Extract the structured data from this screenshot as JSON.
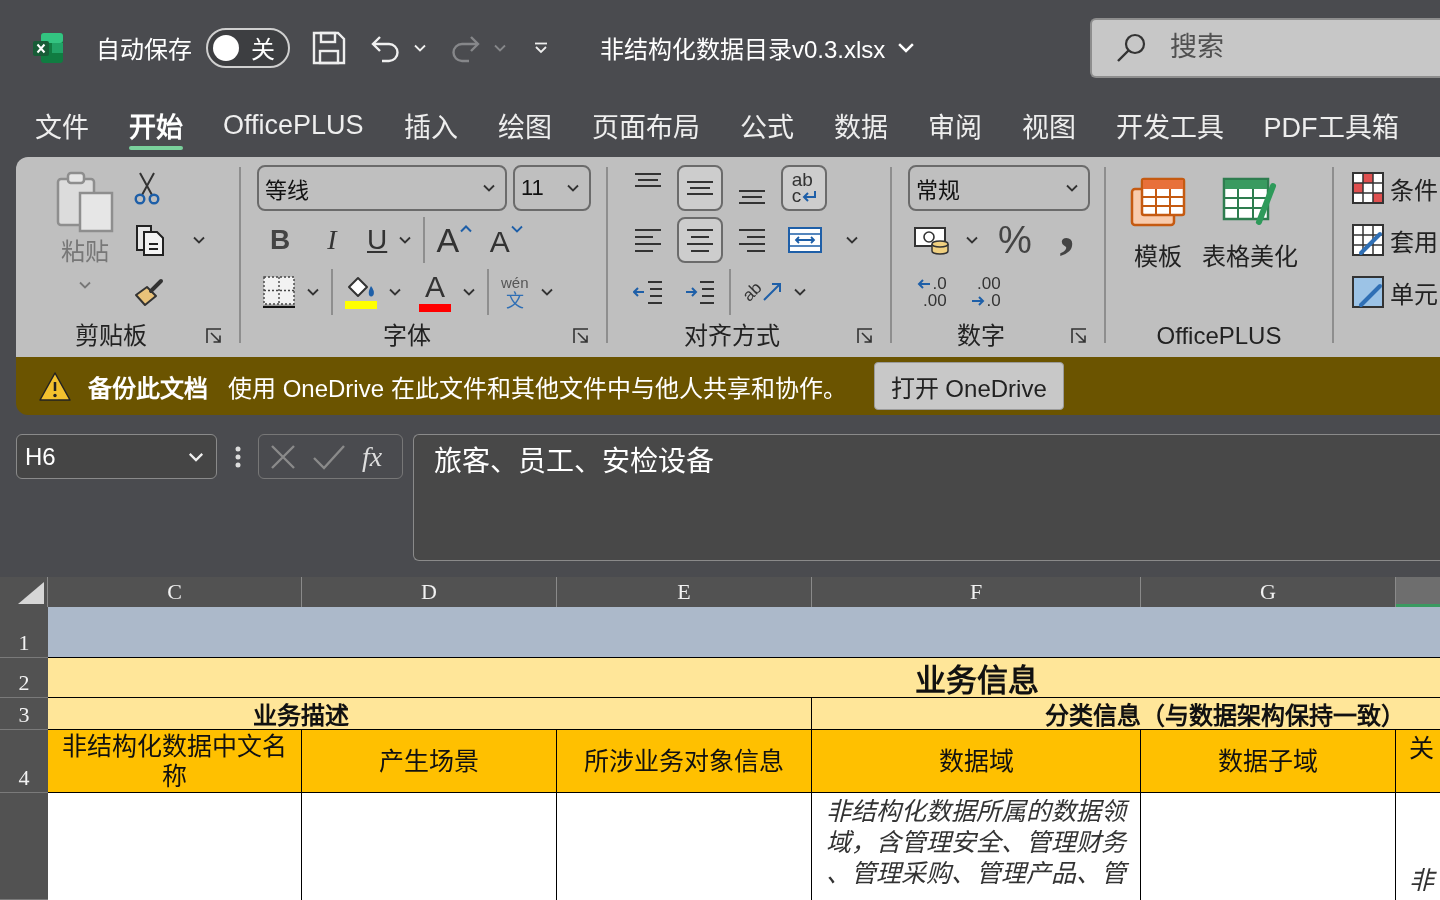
{
  "title_bar": {
    "autosave": {
      "label": "自动保存",
      "on": false,
      "state_label": "关"
    },
    "undo": {
      "disabled": false
    },
    "redo": {
      "disabled": true
    },
    "file_name": "非结构化数据目录v0.3.xlsx",
    "search": {
      "placeholder": "搜索"
    }
  },
  "tabs": [
    {
      "label": "文件",
      "selected": false
    },
    {
      "label": "开始",
      "selected": true
    },
    {
      "label": "OfficePLUS",
      "selected": false
    },
    {
      "label": "插入",
      "selected": false
    },
    {
      "label": "绘图",
      "selected": false
    },
    {
      "label": "页面布局",
      "selected": false
    },
    {
      "label": "公式",
      "selected": false
    },
    {
      "label": "数据",
      "selected": false
    },
    {
      "label": "审阅",
      "selected": false
    },
    {
      "label": "视图",
      "selected": false
    },
    {
      "label": "开发工具",
      "selected": false
    },
    {
      "label": "PDF工具箱",
      "selected": false
    }
  ],
  "ribbon": {
    "groups": [
      {
        "kind": "clipboard",
        "label": "剪贴板",
        "launcher": true,
        "paste": {
          "label": "粘贴",
          "disabled": true
        }
      },
      {
        "kind": "font",
        "label": "字体",
        "launcher": true,
        "font_name": "等线",
        "font_size": "11",
        "bold": "B",
        "italic": "I",
        "underline": "U",
        "grow": "A",
        "shrink": "A",
        "highlight": {
          "color": "#ffff00"
        },
        "font_color": {
          "glyph": "A",
          "color": "#ff0000"
        },
        "phonetic": [
          "wén",
          "文"
        ]
      },
      {
        "kind": "alignment",
        "label": "对齐方式",
        "launcher": true,
        "rows": [
          [
            {
              "kind": "align-top",
              "on": false
            },
            {
              "kind": "align-middle",
              "on": true
            },
            {
              "kind": "align-bottom",
              "on": false
            },
            {
              "kind": "wrap-text",
              "on": true,
              "glyph": [
                "ab",
                "c"
              ]
            }
          ],
          [
            {
              "kind": "align-left",
              "on": false
            },
            {
              "kind": "align-center",
              "on": true
            },
            {
              "kind": "align-right",
              "on": false
            },
            {
              "kind": "merge",
              "on": false
            }
          ],
          [
            {
              "kind": "indent-decrease",
              "on": false
            },
            {
              "kind": "indent-increase",
              "on": false
            },
            {
              "kind": "orientation",
              "on": false,
              "glyph": [
                "ab"
              ]
            }
          ]
        ]
      },
      {
        "kind": "number",
        "label": "数字",
        "launcher": true,
        "format": "常规",
        "percent": "%",
        "comma": ",",
        "increase_decimal": [
          ".0",
          ".00"
        ],
        "decrease_decimal": [
          ".00",
          ".0"
        ]
      },
      {
        "kind": "gallery",
        "label": "OfficePLUS",
        "launcher": false,
        "items": [
          {
            "kind": "template",
            "label": "模板"
          },
          {
            "kind": "beautify",
            "label": "表格美化"
          }
        ]
      },
      {
        "kind": "styles",
        "items": [
          {
            "kind": "conditional",
            "label": "条件"
          },
          {
            "kind": "table-format",
            "label": "套用"
          },
          {
            "kind": "cell-style",
            "label": "单元"
          }
        ]
      }
    ]
  },
  "notification": {
    "title": "备份此文档",
    "message": "使用 OneDrive 在此文件和其他文件中与他人共享和协作。",
    "button": "打开 OneDrive"
  },
  "formula_bar": {
    "name_box": "H6",
    "function_glyph": "fx",
    "formula": "旅客、员工、安检设备"
  },
  "sheet": {
    "columns": [
      {
        "label": "C",
        "selected": false
      },
      {
        "label": "D",
        "selected": false
      },
      {
        "label": "E",
        "selected": false
      },
      {
        "label": "F",
        "selected": false
      },
      {
        "label": "G",
        "selected": false
      },
      {
        "selected": true
      }
    ],
    "rows": [
      {
        "label": "1",
        "kind": "band"
      },
      {
        "label": "2",
        "kind": "title",
        "text": "业务信息"
      },
      {
        "label": "3",
        "kind": "groups",
        "cells": [
          {
            "text": "业务描述"
          },
          {
            "text": "分类信息（与数据架构保持一致）"
          }
        ]
      },
      {
        "label": "4",
        "kind": "header",
        "cells": [
          {
            "text": "非结构化数据中文名称"
          },
          {
            "text": "产生场景"
          },
          {
            "text": "所涉业务对象信息"
          },
          {
            "text": "数据域"
          },
          {
            "text": "数据子域"
          },
          {
            "text": "关"
          }
        ]
      },
      {
        "kind": "body",
        "cells": [
          {
            "kind": "blank"
          },
          {
            "kind": "blank"
          },
          {
            "kind": "blank"
          },
          {
            "kind": "hint",
            "text": "非结构化数据所属的数据领域，含管理安全、管理财务、管理采购、管理产品、管"
          },
          {
            "kind": "blank"
          },
          {
            "kind": "hint",
            "text": "非"
          }
        ]
      }
    ]
  }
}
